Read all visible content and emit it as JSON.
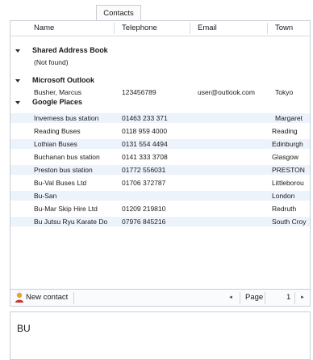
{
  "tabs": [
    {
      "label": "Contacts"
    }
  ],
  "columns": {
    "name": "Name",
    "telephone": "Telephone",
    "email": "Email",
    "town": "Town"
  },
  "groups": [
    {
      "title": "Shared Address Book",
      "rows": [
        {
          "name": "(Not found)",
          "telephone": "",
          "email": "",
          "town": ""
        }
      ]
    },
    {
      "title": "Microsoft Outlook",
      "rows": [
        {
          "name": "Busher, Marcus",
          "telephone": "123456789",
          "email": "user@outlook.com",
          "town": "Tokyo"
        }
      ]
    },
    {
      "title": "Google Places",
      "rows": [
        {
          "name": "Inverness bus station",
          "telephone": "01463 233 371",
          "email": "",
          "town": "Margaret"
        },
        {
          "name": "Reading Buses",
          "telephone": "0118 959 4000",
          "email": "",
          "town": "Reading"
        },
        {
          "name": "Lothian Buses",
          "telephone": "0131 554 4494",
          "email": "",
          "town": "Edinburgh"
        },
        {
          "name": "Buchanan bus station",
          "telephone": "0141 333 3708",
          "email": "",
          "town": "Glasgow"
        },
        {
          "name": "Preston bus station",
          "telephone": "01772 556031",
          "email": "",
          "town": "PRESTON"
        },
        {
          "name": "Bu-Val Buses Ltd",
          "telephone": "01706 372787",
          "email": "",
          "town": "Littleborou"
        },
        {
          "name": "Bu-San",
          "telephone": "",
          "email": "",
          "town": "London"
        },
        {
          "name": "Bu-Mar Skip Hire Ltd",
          "telephone": "01209 219810",
          "email": "",
          "town": "Redruth"
        },
        {
          "name": "Bu Jutsu Ryu Karate Do",
          "telephone": "07976 845216",
          "email": "",
          "town": "South Croy"
        }
      ]
    }
  ],
  "footer": {
    "new_contact": "New contact",
    "page_label": "Page",
    "page_number": "1",
    "prev_symbol": "◄",
    "next_symbol": "►"
  },
  "search": {
    "value": "BU"
  },
  "colors": {
    "border": "#c9ced6",
    "row_shade": "#ecf3fb",
    "accent": "#e8a23a"
  }
}
